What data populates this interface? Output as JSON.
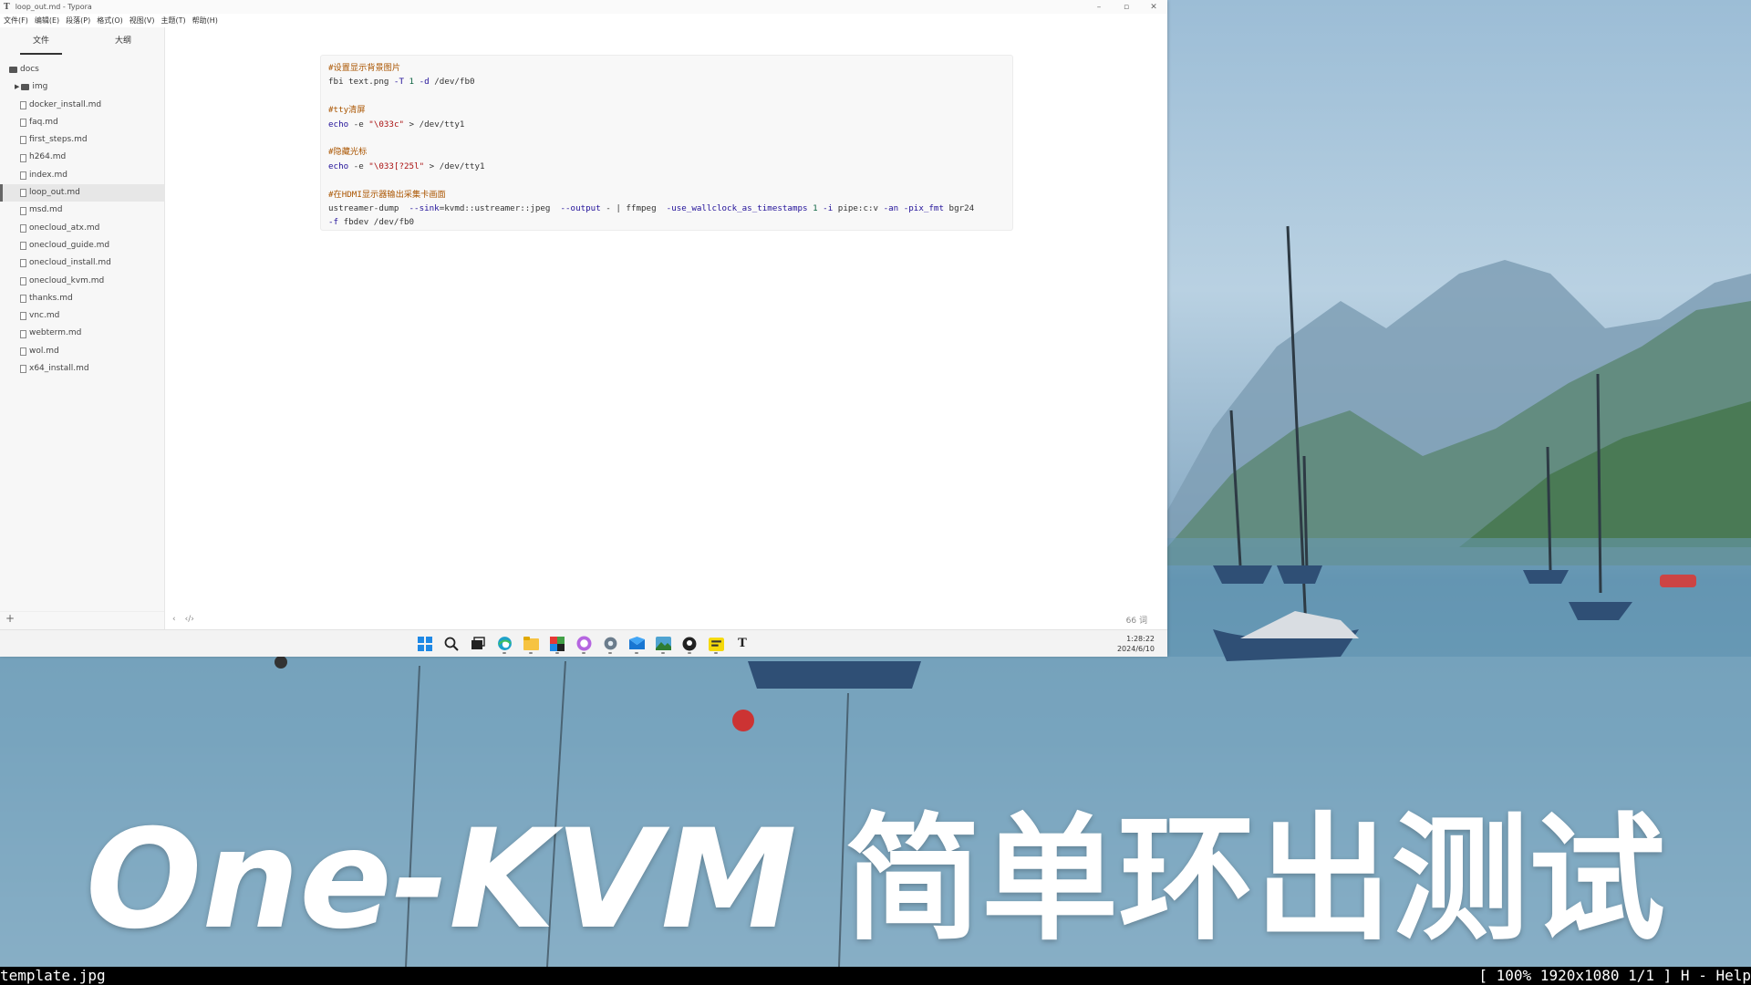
{
  "window": {
    "title": "loop_out.md - Typora",
    "app_icon": "T",
    "controls": [
      "–",
      "▫",
      "✕"
    ]
  },
  "menu": [
    "文件(F)",
    "编辑(E)",
    "段落(P)",
    "格式(O)",
    "视图(V)",
    "主题(T)",
    "帮助(H)"
  ],
  "sidebar": {
    "tabs": [
      "文件",
      "大纲"
    ],
    "root": "docs",
    "folder": "img",
    "files": [
      "docker_install.md",
      "faq.md",
      "first_steps.md",
      "h264.md",
      "index.md",
      "loop_out.md",
      "msd.md",
      "onecloud_atx.md",
      "onecloud_guide.md",
      "onecloud_install.md",
      "onecloud_kvm.md",
      "thanks.md",
      "vnc.md",
      "webterm.md",
      "wol.md",
      "x64_install.md"
    ],
    "active_file": "loop_out.md",
    "add_label": "+"
  },
  "code": {
    "c1": "#设置显示背景图片",
    "l1a": "fbi text.png ",
    "l1b": "-T",
    "l1c": " ",
    "l1d": "1",
    "l1e": " ",
    "l1f": "-d",
    "l1g": " /dev/fb0",
    "c2": "#tty清屏",
    "l2a": "echo",
    "l2b": " -e ",
    "l2c": "\"\\033c\"",
    "l2d": " > /dev/tty1",
    "c3": "#隐藏光标",
    "l3a": "echo",
    "l3b": " -e ",
    "l3c": "\"\\033[?25l\"",
    "l3d": " > /dev/tty1",
    "c4": "#在HDMI显示器输出采集卡画面",
    "l4a": "ustreamer-dump  ",
    "l4b": "--sink",
    "l4c": "=kvmd::ustreamer::jpeg  ",
    "l4d": "--output",
    "l4e": " - | ffmpeg  ",
    "l4f": "-use_wallclock_as_timestamps",
    "l4g": " 1 ",
    "l4h": "-i",
    "l4i": " pipe:c:v ",
    "l4j": "-an",
    "l4k": " ",
    "l4l": "-pix_fmt",
    "l4m": " bgr24",
    "l5a": "-f",
    "l5b": " fbdev /dev/fb0"
  },
  "status": {
    "back": "‹",
    "source": "‹/›",
    "word_count": "66 词"
  },
  "taskbar": {
    "time": "1:28:22",
    "date": "2024/6/10",
    "icons": [
      "windows-start-icon",
      "search-icon",
      "task-view-icon",
      "edge-browser-icon",
      "file-explorer-icon",
      "store-icon",
      "app-purple-icon",
      "settings-icon",
      "mail-icon",
      "photos-icon",
      "github-icon",
      "notes-icon",
      "typora-icon"
    ]
  },
  "caption": {
    "latin": "One-KVM",
    "cjk": "简单环出测试"
  },
  "viewer": {
    "filename": "template.jpg",
    "info": "[ 100% 1920x1080 1/1 ] H - Help"
  }
}
